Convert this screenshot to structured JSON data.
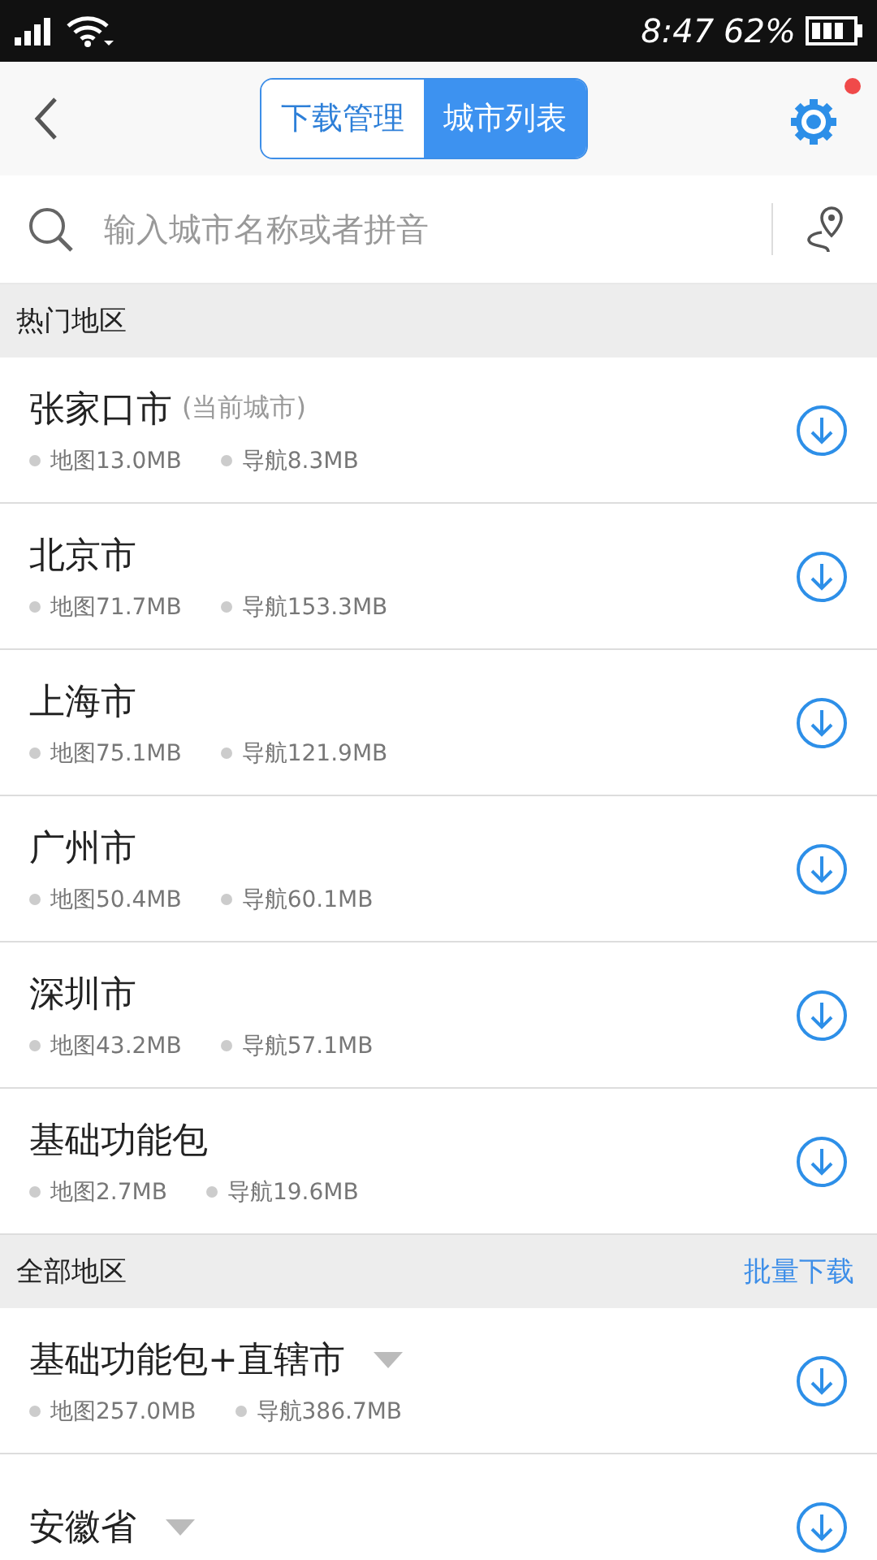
{
  "status_bar": {
    "time": "8:47",
    "battery": "62%"
  },
  "header": {
    "tabs": [
      {
        "label": "下载管理",
        "selected": false
      },
      {
        "label": "城市列表",
        "selected": true
      }
    ],
    "settings_badge": true
  },
  "search": {
    "placeholder": "输入城市名称或者拼音"
  },
  "sections": [
    {
      "title": "热门地区",
      "items": [
        {
          "kind": "city",
          "name": "张家口市",
          "note": "(当前城市)",
          "map": "地图13.0MB",
          "nav": "导航8.3MB"
        },
        {
          "kind": "city",
          "name": "北京市",
          "map": "地图71.7MB",
          "nav": "导航153.3MB"
        },
        {
          "kind": "city",
          "name": "上海市",
          "map": "地图75.1MB",
          "nav": "导航121.9MB"
        },
        {
          "kind": "city",
          "name": "广州市",
          "map": "地图50.4MB",
          "nav": "导航60.1MB"
        },
        {
          "kind": "city",
          "name": "深圳市",
          "map": "地图43.2MB",
          "nav": "导航57.1MB"
        },
        {
          "kind": "city",
          "name": "基础功能包",
          "map": "地图2.7MB",
          "nav": "导航19.6MB"
        }
      ]
    },
    {
      "title": "全部地区",
      "action": "批量下载",
      "items": [
        {
          "kind": "group",
          "name": "基础功能包+直辖市",
          "map": "地图257.0MB",
          "nav": "导航386.7MB"
        },
        {
          "kind": "group",
          "name": "安徽省"
        }
      ]
    }
  ]
}
